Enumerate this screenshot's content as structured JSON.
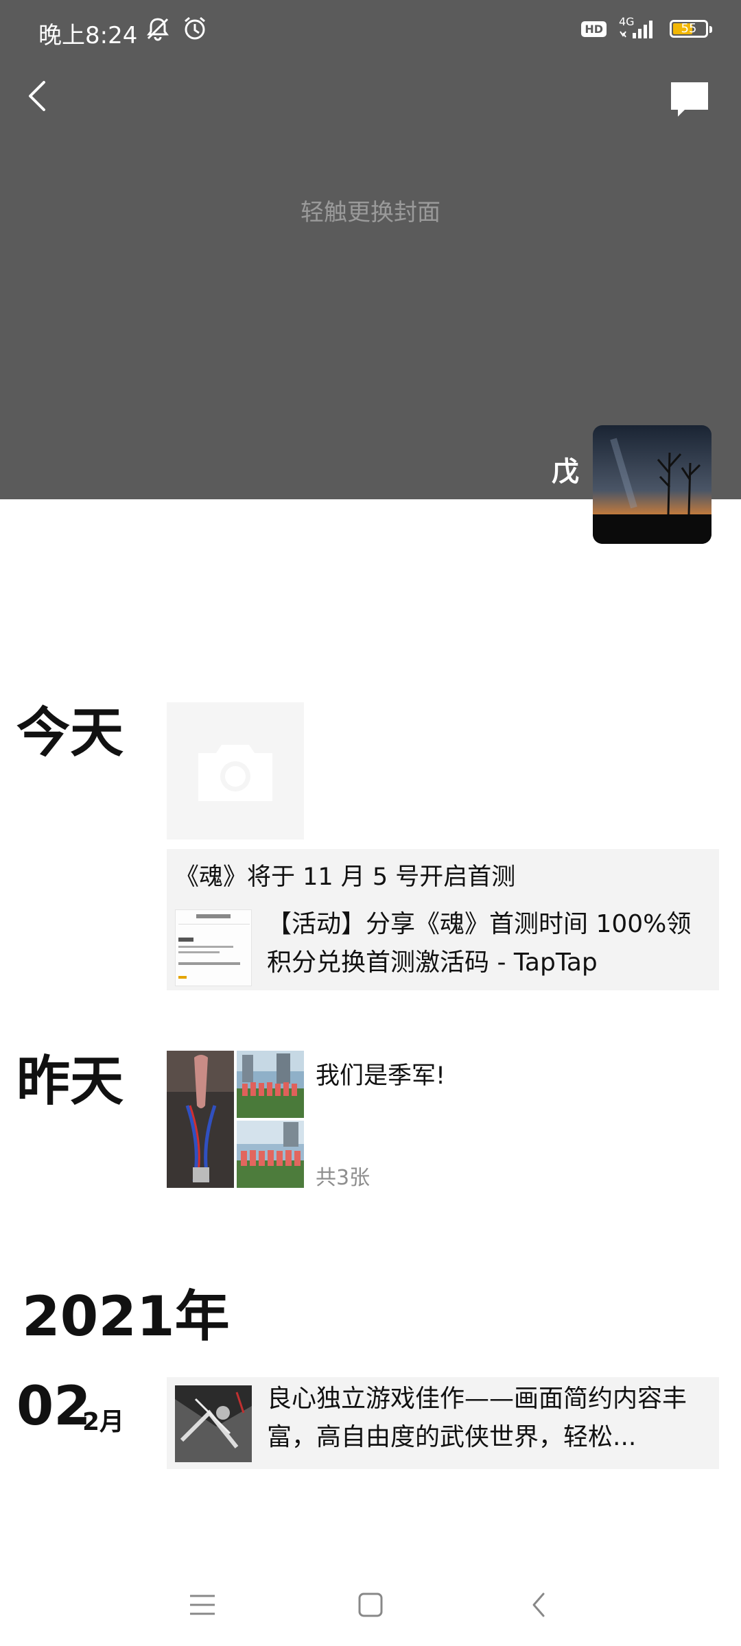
{
  "status_bar": {
    "time": "晚上8:24",
    "hd_label": "HD",
    "network_label": "4G",
    "battery_level": "55",
    "icons": [
      "mute-bell-icon",
      "alarm-icon",
      "signal-icon",
      "battery-icon"
    ]
  },
  "header": {
    "cover_hint": "轻触更换封面",
    "back_icon": "back-arrow-icon",
    "message_icon": "message-icon"
  },
  "profile": {
    "name": "戊"
  },
  "timeline": {
    "today": {
      "label": "今天",
      "share": {
        "title": "《魂》将于 11 月 5 号开启首测",
        "link_text": "【活动】分享《魂》首测时间 100%领积分兑换首测激活码 - TapTap"
      }
    },
    "yesterday": {
      "label": "昨天",
      "caption": "我们是季军!",
      "count": "共3张"
    },
    "year": "2021年",
    "entry_2021": {
      "day": "02",
      "month": "2月",
      "text": "良心独立游戏佳作——画面简约内容丰富，高自由度的武侠世界，轻松..."
    }
  },
  "nav_bar": {
    "icons": [
      "menu-icon",
      "home-icon",
      "back-icon"
    ]
  },
  "colors": {
    "cover_bg": "#5b5b5b",
    "card_bg": "#f3f3f3",
    "battery_fill": "#f2b705"
  }
}
